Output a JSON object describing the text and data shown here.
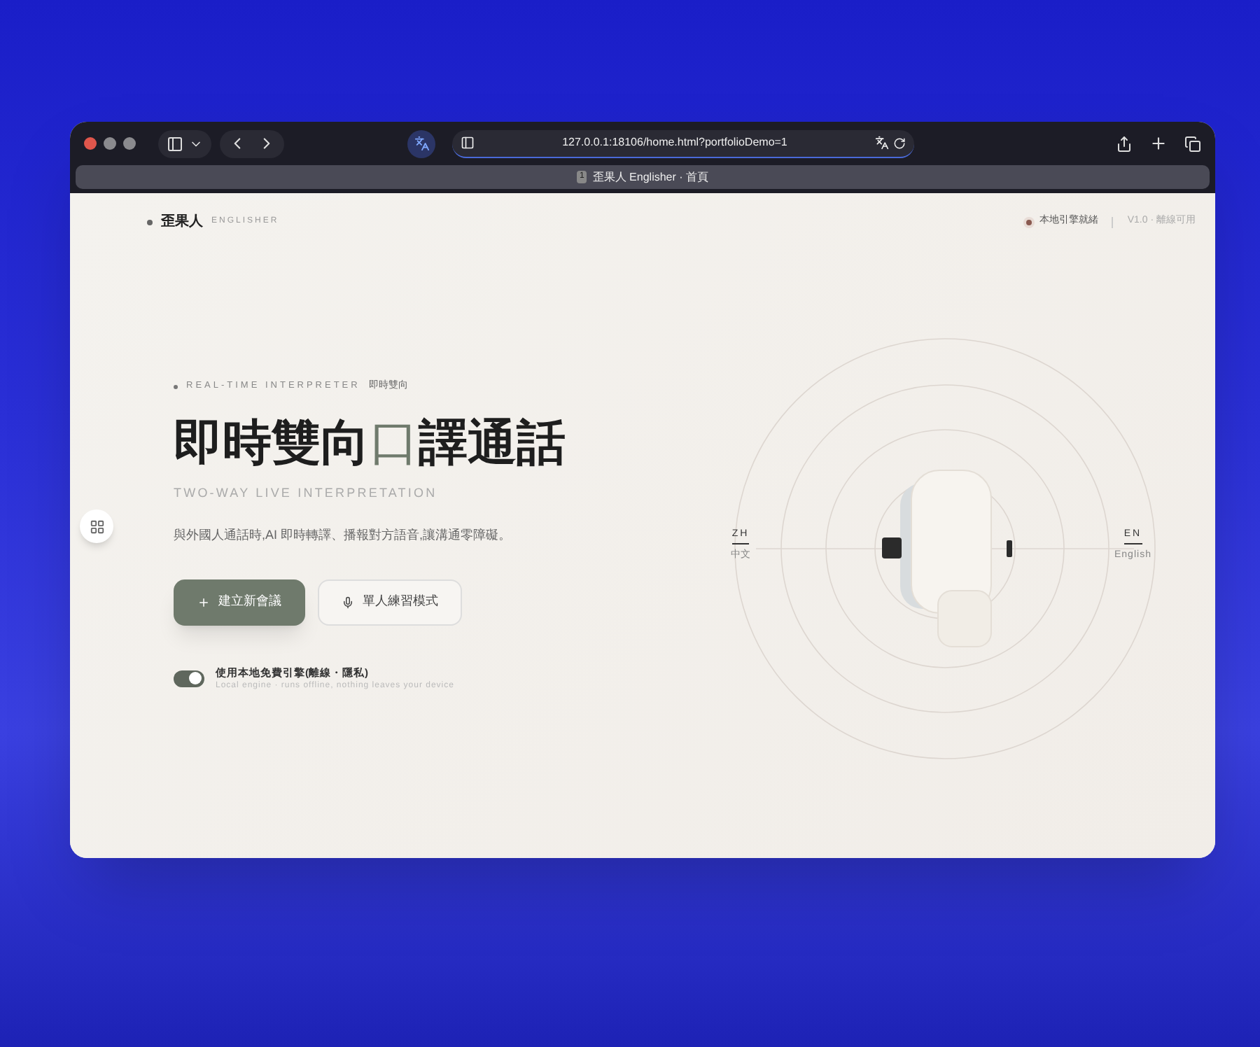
{
  "browser": {
    "url": "127.0.0.1:18106/home.html?portfolioDemo=1",
    "tab": {
      "index": "1",
      "title": "歪果人 Englisher · 首頁",
      "selected": true
    }
  },
  "header": {
    "brand": "歪果人",
    "brand_sub": "ENGLISHER",
    "status": "本地引擎就緒",
    "version": "V1.0 · 離線可用"
  },
  "hero": {
    "eyebrow": "REAL-TIME INTERPRETER",
    "eyebrow_zh": "即時雙向",
    "title": [
      {
        "text": "即時雙向",
        "accent": false
      },
      {
        "text": "口",
        "accent": true
      },
      {
        "text": "譯通話",
        "accent": false
      }
    ],
    "subtitle": "TWO-WAY LIVE INTERPRETATION",
    "description": "與外國人通話時,AI 即時轉譯、播報對方語音,讓溝通零障礙。",
    "buttons": [
      {
        "kind": "primary",
        "label": "建立新會議"
      },
      {
        "kind": "secondary",
        "label": "單人練習模式"
      }
    ],
    "engine_toggle": {
      "on": true,
      "label": "使用本地免費引擎(離線・隱私)",
      "hint": "Local engine · runs offline, nothing leaves your device"
    }
  },
  "languages": {
    "left": {
      "code": "ZH",
      "name": "中文"
    },
    "right": {
      "code": "EN",
      "name": "English"
    }
  }
}
